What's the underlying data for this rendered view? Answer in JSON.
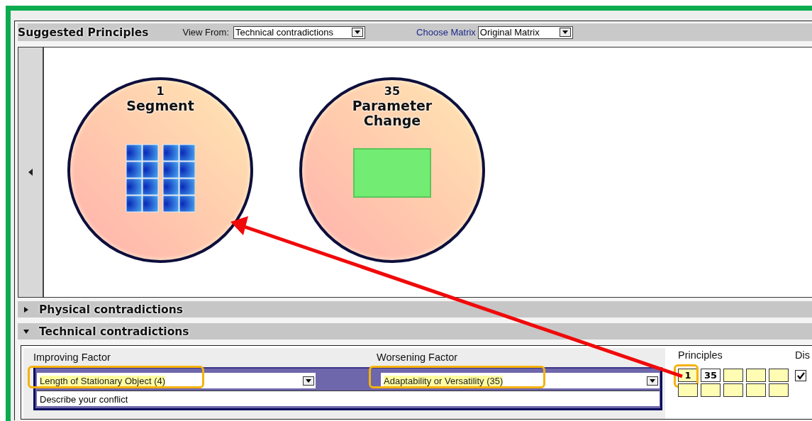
{
  "header": {
    "title": "Suggested Principles",
    "view_from": {
      "label": "View From:",
      "value": "Technical contradictions"
    },
    "matrix": {
      "label": "Choose Matrix",
      "value": "Original Matrix"
    }
  },
  "principle_cards": [
    {
      "number": "1",
      "name": "Segment",
      "kind": "segment"
    },
    {
      "number": "35",
      "name": "Parameter Change",
      "kind": "parameter"
    }
  ],
  "sections": [
    {
      "title": "Physical contradictions",
      "expanded": false
    },
    {
      "title": "Technical contradictions",
      "expanded": true
    }
  ],
  "conflict": {
    "improving": {
      "label": "Improving Factor",
      "value": "Length of Stationary Object (4)",
      "highlighted": true
    },
    "worsening": {
      "label": "Worsening Factor",
      "value": "Adaptability or Versatility (35)",
      "highlighted": true
    },
    "description": "Describe your conflict",
    "principles_label": "Principles",
    "principles": [
      {
        "value": "1",
        "selected": false,
        "highlighted": true
      },
      {
        "value": "35",
        "selected": true,
        "highlighted": false
      }
    ],
    "column_4": {
      "label": "Dis",
      "checked": true
    }
  },
  "annotation_arrow": true
}
